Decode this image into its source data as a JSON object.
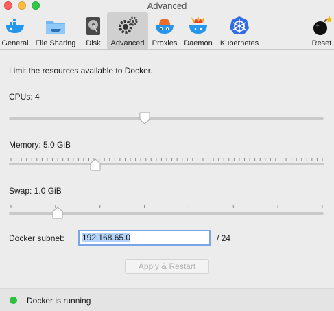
{
  "window": {
    "title": "Advanced"
  },
  "toolbar": {
    "items": [
      {
        "label": "General",
        "icon": "whale-general-icon"
      },
      {
        "label": "File Sharing",
        "icon": "folder-whale-icon"
      },
      {
        "label": "Disk",
        "icon": "disk-icon"
      },
      {
        "label": "Advanced",
        "icon": "gears-icon",
        "active": true
      },
      {
        "label": "Proxies",
        "icon": "whale-proxies-icon"
      },
      {
        "label": "Daemon",
        "icon": "whale-daemon-icon"
      },
      {
        "label": "Kubernetes",
        "icon": "kubernetes-icon"
      },
      {
        "label": "Reset",
        "icon": "bomb-icon"
      }
    ]
  },
  "main": {
    "intro": "Limit the resources available to Docker.",
    "cpus": {
      "label": "CPUs: 4",
      "value": 4,
      "min": 1,
      "max": 8
    },
    "memory": {
      "label": "Memory: 5.0 GiB",
      "value": 5.0,
      "min": 1,
      "max": 16
    },
    "swap": {
      "label": "Swap: 1.0 GiB",
      "value": 1.0,
      "min": 0.5,
      "max": 4
    },
    "subnet": {
      "label": "Docker subnet:",
      "value": "192.168.65.0",
      "suffix": "/ 24"
    },
    "apply_label": "Apply & Restart"
  },
  "status": {
    "text": "Docker is running",
    "color": "#2ec03e"
  },
  "colors": {
    "accent": "#7aa6e8",
    "selection": "#b4d3fb"
  }
}
